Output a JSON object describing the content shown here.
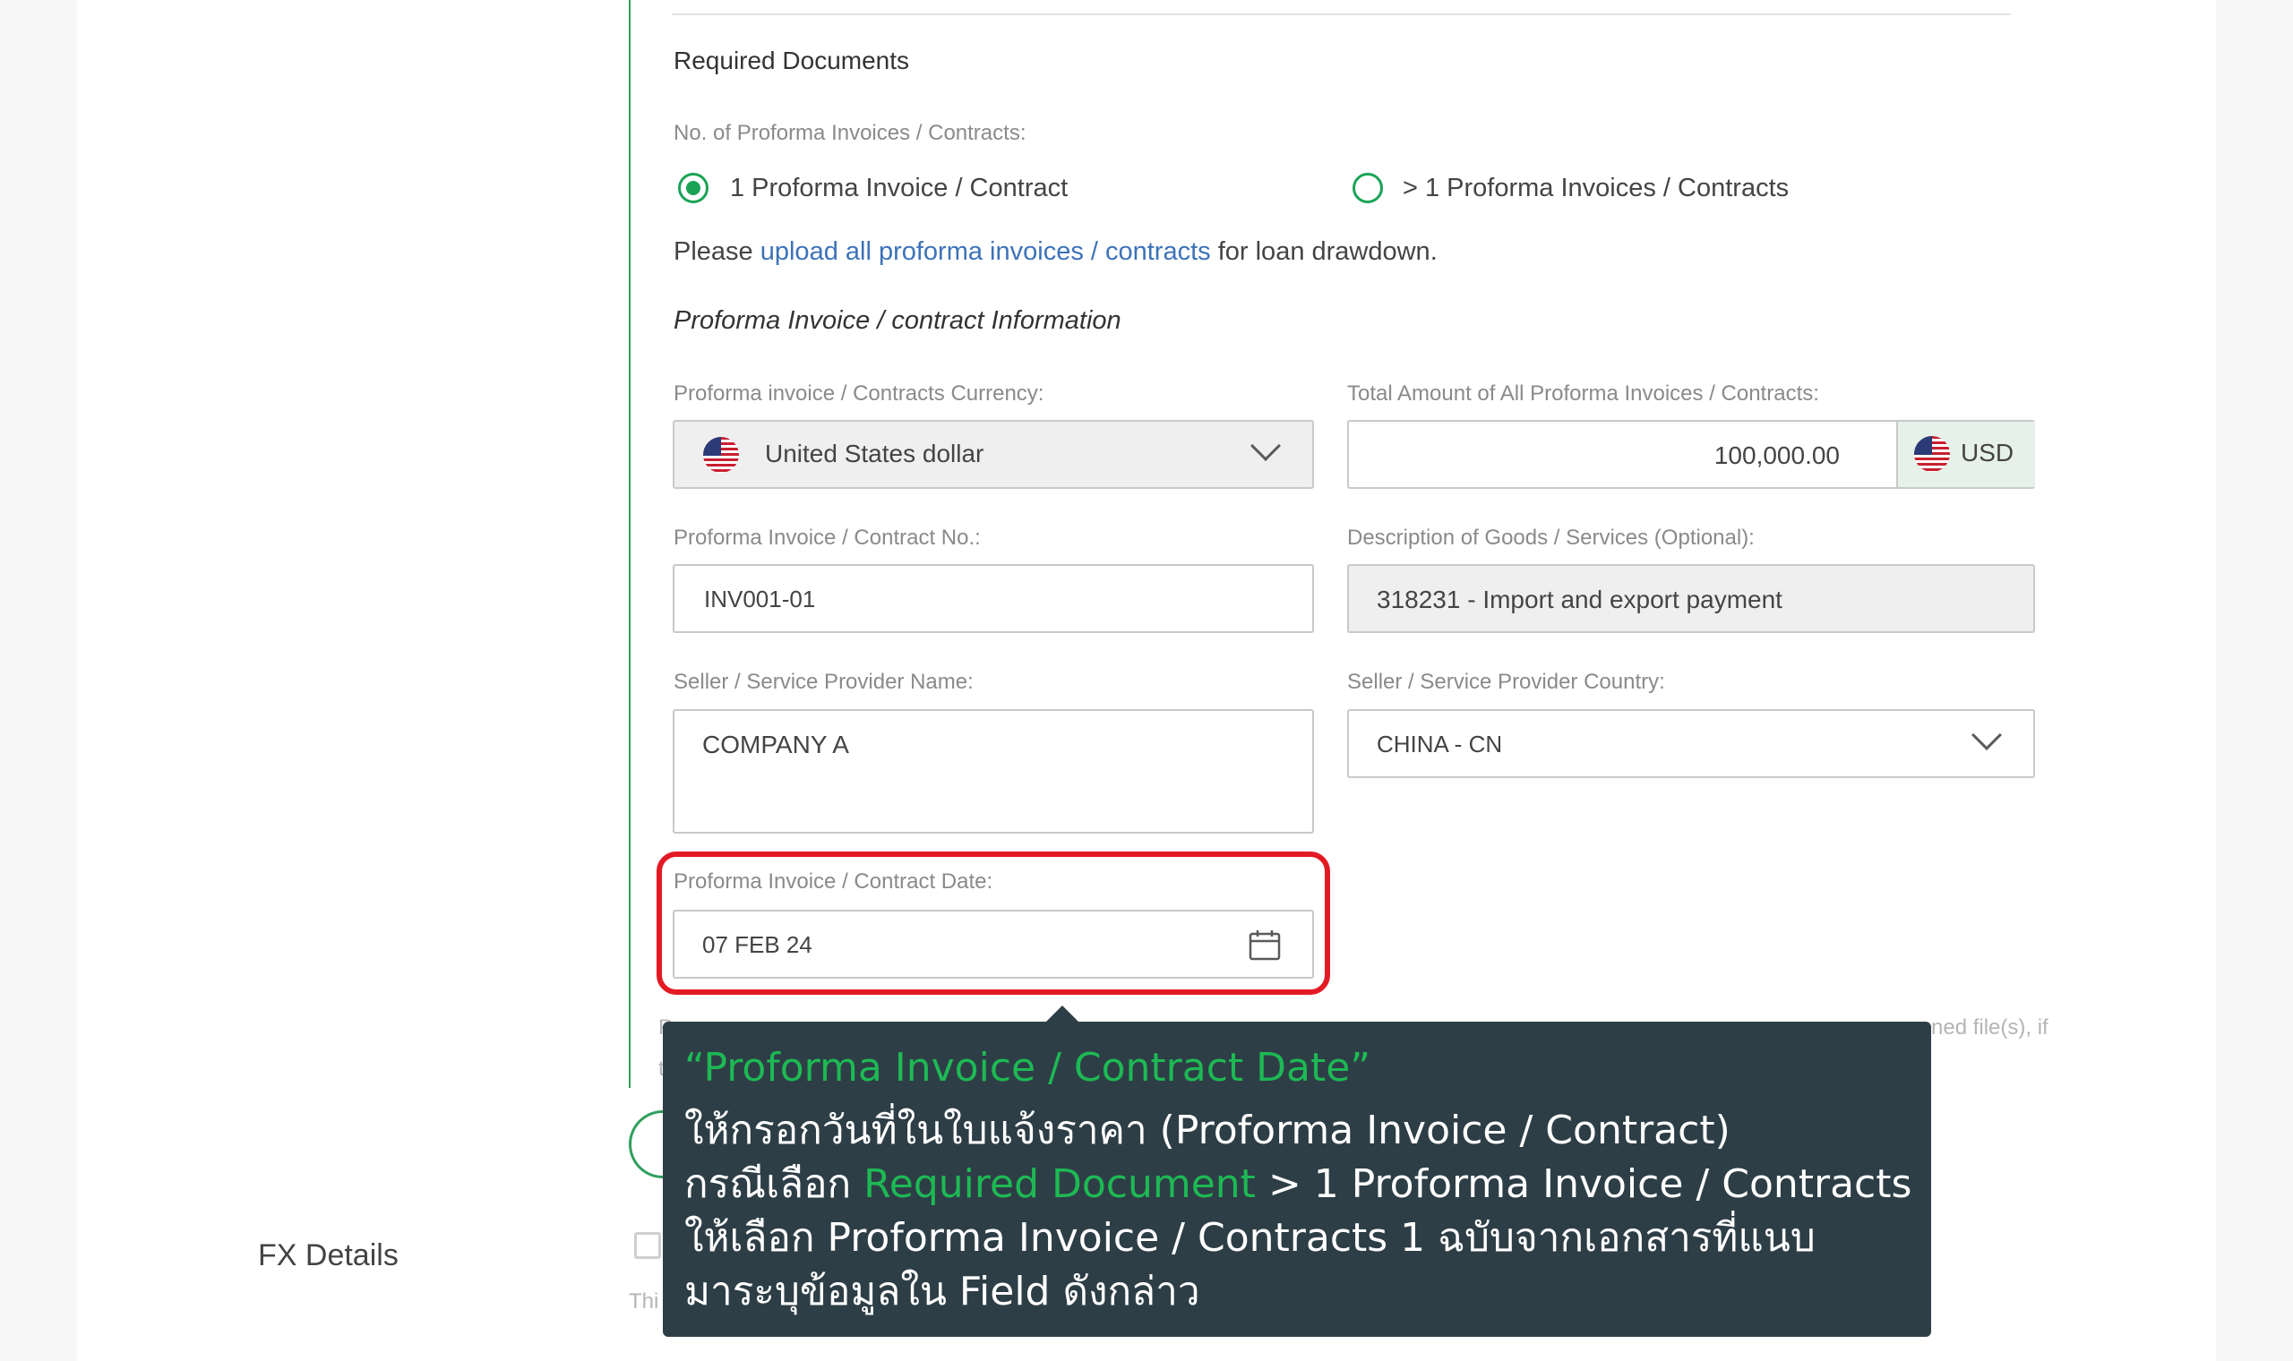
{
  "required_documents": {
    "heading": "Required Documents",
    "count_label": "No. of Proforma Invoices / Contracts:",
    "options": [
      {
        "label": "1 Proforma Invoice / Contract",
        "selected": true
      },
      {
        "label": "> 1 Proforma Invoices / Contracts",
        "selected": false
      }
    ],
    "info_prefix": "Please",
    "info_link": "upload all proforma invoices / contracts",
    "info_suffix": "for loan drawdown."
  },
  "invoice_info": {
    "subheading": "Proforma Invoice / contract Information",
    "currency_label": "Proforma invoice / Contracts Currency:",
    "currency_value": "United States dollar",
    "total_label": "Total Amount of All Proforma Invoices / Contracts:",
    "total_value": "100,000.00",
    "total_currency": "USD",
    "invoice_no_label": "Proforma Invoice / Contract No.:",
    "invoice_no_value": "INV001-01",
    "description_label": "Description of Goods / Services (Optional):",
    "description_value": "318231 - Import and export payment",
    "seller_name_label": "Seller / Service Provider Name:",
    "seller_name_value": "COMPANY A",
    "seller_country_label": "Seller / Service Provider Country:",
    "seller_country_value": "CHINA - CN",
    "date_label": "Proforma Invoice / Contract Date:",
    "date_value": "07 FEB 24"
  },
  "background_text": {
    "obscured_right": "ned file(s), if",
    "obscured_left": "P",
    "obscured_left2": "t",
    "fx_partial": "Thi"
  },
  "fx": {
    "label": "FX Details"
  },
  "tooltip": {
    "line1": "“Proforma Invoice / Contract Date”",
    "line2": "ให้กรอกวันที่ในใบแจ้งราคา (Proforma Invoice / Contract)",
    "line3_prefix": "กรณีเลือก",
    "line3_green": "Required Document",
    "line3_suffix": "> 1 Proforma Invoice / Contracts",
    "line4": "ให้เลือก Proforma Invoice / Contracts 1 ฉบับจากเอกสารที่แนบ",
    "line5": "มาระบุข้อมูลใน Field ดังกล่าว"
  },
  "colors": {
    "accent_green": "#1aa356",
    "link_blue": "#3d72b8",
    "highlight_red": "#e31a24",
    "tooltip_bg": "#2e3e46"
  },
  "icons": [
    "us-flag-icon",
    "chevron-down-icon",
    "calendar-icon"
  ]
}
